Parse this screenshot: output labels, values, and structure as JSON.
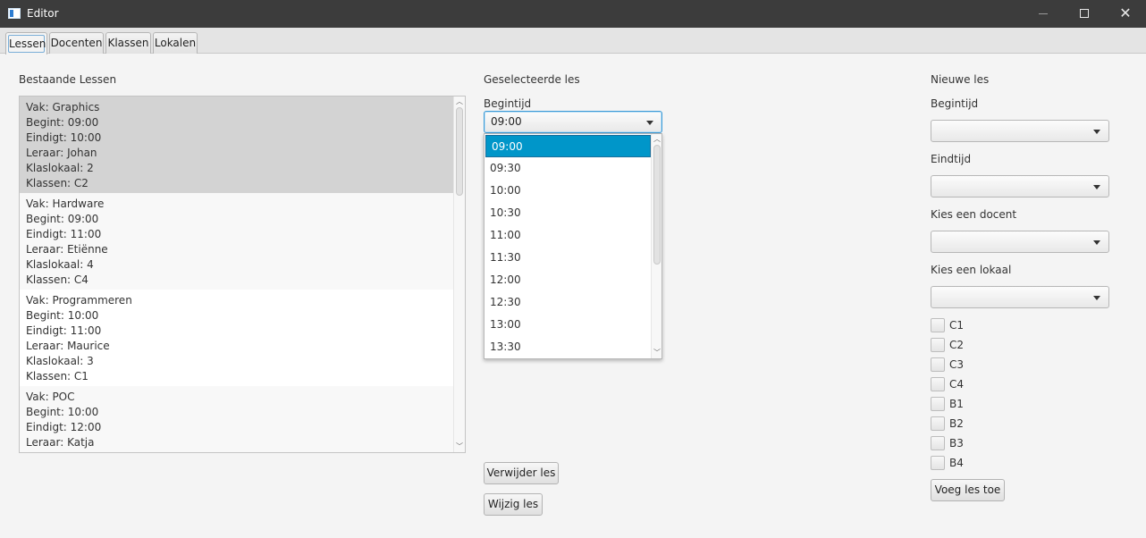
{
  "window": {
    "title": "Editor"
  },
  "tabs": [
    {
      "label": "Lessen",
      "active": true
    },
    {
      "label": "Docenten",
      "active": false
    },
    {
      "label": "Klassen",
      "active": false
    },
    {
      "label": "Lokalen",
      "active": false
    }
  ],
  "existing": {
    "header": "Bestaande Lessen",
    "items": [
      {
        "lines": [
          "Vak: Graphics",
          "Begint: 09:00",
          "Eindigt: 10:00",
          "Leraar: Johan",
          "Klaslokaal: 2",
          "Klassen: C2"
        ],
        "selected": true
      },
      {
        "lines": [
          "Vak: Hardware",
          "Begint: 09:00",
          "Eindigt: 11:00",
          "Leraar: Etiënne",
          "Klaslokaal: 4",
          "Klassen: C4"
        ],
        "selected": false
      },
      {
        "lines": [
          "Vak: Programmeren",
          "Begint: 10:00",
          "Eindigt: 11:00",
          "Leraar: Maurice",
          "Klaslokaal: 3",
          "Klassen: C1"
        ],
        "selected": false
      },
      {
        "lines": [
          "Vak: POC",
          "Begint: 10:00",
          "Eindigt: 12:00",
          "Leraar: Katja"
        ],
        "selected": false
      }
    ]
  },
  "selected_lesson": {
    "header": "Geselecteerde les",
    "begintijd_label": "Begintijd",
    "begintijd_value": "09:00",
    "time_options": [
      "09:00",
      "09:30",
      "10:00",
      "10:30",
      "11:00",
      "11:30",
      "12:00",
      "12:30",
      "13:00",
      "13:30"
    ],
    "highlighted_option": "09:00",
    "delete_button": "Verwijder les",
    "edit_button": "Wijzig les"
  },
  "new_lesson": {
    "header": "Nieuwe les",
    "begintijd_label": "Begintijd",
    "eindtijd_label": "Eindtijd",
    "docent_label": "Kies een docent",
    "lokaal_label": "Kies een lokaal",
    "classes": [
      "C1",
      "C2",
      "C3",
      "C4",
      "B1",
      "B2",
      "B3",
      "B4"
    ],
    "add_button": "Voeg les toe"
  },
  "colors": {
    "titlebar": "#3c3c3c",
    "selection": "#0096c9",
    "focus_border": "#3c9ad6",
    "list_selected": "#d3d3d3"
  }
}
